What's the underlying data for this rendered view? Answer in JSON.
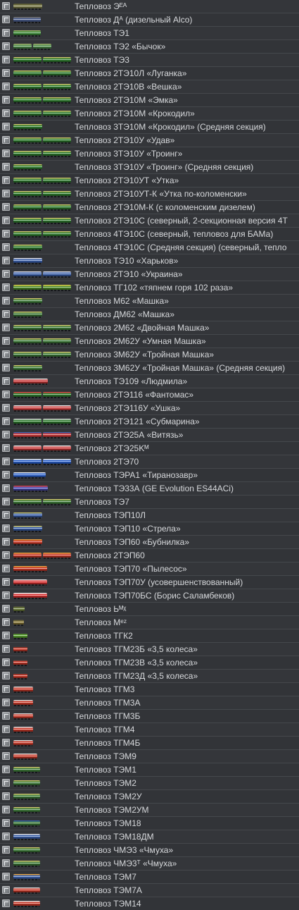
{
  "items": [
    {
      "label": "Тепловоз Эᴱᴬ",
      "thumb": {
        "colors": [
          "#7a7a4a",
          "#555533"
        ],
        "segments": 1,
        "len": 0.5
      }
    },
    {
      "label": "Тепловоз Дᴬ (дизельный Alco)",
      "thumb": {
        "colors": [
          "#4a5c8a",
          "#6d6d6d"
        ],
        "segments": 1,
        "len": 0.48
      }
    },
    {
      "label": "Тепловоз ТЭ1",
      "thumb": {
        "colors": [
          "#3e8a3a",
          "#9aaa6a"
        ],
        "segments": 1,
        "len": 0.48
      }
    },
    {
      "label": "Тепловоз ТЭ2 «Бычок»",
      "thumb": {
        "colors": [
          "#4e8a4a",
          "#9aaa6a"
        ],
        "segments": 2,
        "len": 0.66
      }
    },
    {
      "label": "Тепловоз ТЭ3",
      "thumb": {
        "colors": [
          "#2f7a2f",
          "#c8c06a"
        ],
        "segments": 2,
        "len": 1.0
      }
    },
    {
      "label": "Тепловоз 2ТЭ10Л «Луганка»",
      "thumb": {
        "colors": [
          "#2f7a2f",
          "#c8c06a"
        ],
        "segments": 2,
        "len": 1.0
      }
    },
    {
      "label": "Тепловоз 2ТЭ10В «Вешка»",
      "thumb": {
        "colors": [
          "#2f7a2f",
          "#c8c06a"
        ],
        "segments": 2,
        "len": 1.0
      }
    },
    {
      "label": "Тепловоз 2ТЭ10М «Эмка»",
      "thumb": {
        "colors": [
          "#2f7a2f",
          "#c8c06a"
        ],
        "segments": 2,
        "len": 1.0
      }
    },
    {
      "label": "Тепловоз 2ТЭ10М «Крокодил»",
      "thumb": {
        "colors": [
          "#2f7a2f",
          "#c8c06a"
        ],
        "segments": 2,
        "len": 1.0
      }
    },
    {
      "label": "Тепловоз 3ТЭ10М «Крокодил» (Средняя секция)",
      "thumb": {
        "colors": [
          "#2f7a2f",
          "#c8c06a"
        ],
        "segments": 1,
        "len": 0.5
      }
    },
    {
      "label": "Тепловоз 2ТЭ10У «Удав»",
      "thumb": {
        "colors": [
          "#2f7a2f",
          "#c8c06a"
        ],
        "segments": 2,
        "len": 1.0
      }
    },
    {
      "label": "Тепловоз 3ТЭ10У «Троинг»",
      "thumb": {
        "colors": [
          "#2f7a2f",
          "#c8c06a"
        ],
        "segments": 2,
        "len": 1.0
      }
    },
    {
      "label": "Тепловоз 3ТЭ10У «Троинг» (Средняя секция)",
      "thumb": {
        "colors": [
          "#2f7a2f",
          "#c8c06a"
        ],
        "segments": 1,
        "len": 0.5
      }
    },
    {
      "label": "Тепловоз 2ТЭ10УТ «Утка»",
      "thumb": {
        "colors": [
          "#2f7a2f",
          "#c8c06a"
        ],
        "segments": 2,
        "len": 1.0
      }
    },
    {
      "label": "Тепловоз 2ТЭ10УТ-К «Утка по-коломенски»",
      "thumb": {
        "colors": [
          "#2f7a2f",
          "#c8c06a"
        ],
        "segments": 2,
        "len": 1.0
      }
    },
    {
      "label": "Тепловоз 2ТЭ10М-К (с коломенским дизелем)",
      "thumb": {
        "colors": [
          "#2f7a2f",
          "#c8c06a"
        ],
        "segments": 2,
        "len": 1.0
      }
    },
    {
      "label": "Тепловоз 2ТЭ10С (северный, 2-секционная версия 4Т",
      "thumb": {
        "colors": [
          "#2f7a2f",
          "#c8c06a"
        ],
        "segments": 2,
        "len": 1.0
      }
    },
    {
      "label": "Тепловоз 4ТЭ10С (северный, тепловоз для БАМа)",
      "thumb": {
        "colors": [
          "#2f7a2f",
          "#c8c06a"
        ],
        "segments": 2,
        "len": 1.0
      }
    },
    {
      "label": "Тепловоз 4ТЭ10С (Средняя секция) (северный, тепло",
      "thumb": {
        "colors": [
          "#2f7a2f",
          "#c8c06a"
        ],
        "segments": 1,
        "len": 0.5
      }
    },
    {
      "label": "Тепловоз ТЭ10 «Харьков»",
      "thumb": {
        "colors": [
          "#3a5fa8",
          "#d8d8e0"
        ],
        "segments": 1,
        "len": 0.5
      }
    },
    {
      "label": "Тепловоз 2ТЭ10 «Украина»",
      "thumb": {
        "colors": [
          "#3a5fa8",
          "#d8d8e0"
        ],
        "segments": 2,
        "len": 1.0
      }
    },
    {
      "label": "Тепловоз ТГ102 «тяпнем горя 102 раза»",
      "thumb": {
        "colors": [
          "#4e8a2a",
          "#d8c84a"
        ],
        "segments": 2,
        "len": 1.0
      }
    },
    {
      "label": "Тепловоз М62 «Машка»",
      "thumb": {
        "colors": [
          "#3e7a3a",
          "#c8c06a"
        ],
        "segments": 1,
        "len": 0.5
      }
    },
    {
      "label": "Тепловоз ДМ62 «Машка»",
      "thumb": {
        "colors": [
          "#3e7a3a",
          "#c8c06a"
        ],
        "segments": 1,
        "len": 0.5
      }
    },
    {
      "label": "Тепловоз 2М62 «Двойная Машка»",
      "thumb": {
        "colors": [
          "#3e7a3a",
          "#c8c06a"
        ],
        "segments": 2,
        "len": 1.0
      }
    },
    {
      "label": "Тепловоз 2М62У «Умная Машка»",
      "thumb": {
        "colors": [
          "#3e7a3a",
          "#c8c06a"
        ],
        "segments": 2,
        "len": 1.0
      }
    },
    {
      "label": "Тепловоз 3М62У «Тройная Машка»",
      "thumb": {
        "colors": [
          "#3e7a3a",
          "#c8c06a"
        ],
        "segments": 2,
        "len": 1.0
      }
    },
    {
      "label": "Тепловоз 3М62У «Тройная Машка» (Средняя секция)",
      "thumb": {
        "colors": [
          "#3e7a3a",
          "#c8c06a"
        ],
        "segments": 1,
        "len": 0.5
      }
    },
    {
      "label": "Тепловоз ТЭ109 «Людмила»",
      "thumb": {
        "colors": [
          "#c83a3a",
          "#e0e0e0"
        ],
        "segments": 1,
        "len": 0.6
      }
    },
    {
      "label": "Тепловоз 2ТЭ116 «Фантомас»",
      "thumb": {
        "colors": [
          "#2f7a2f",
          "#d04040"
        ],
        "segments": 2,
        "len": 1.0
      }
    },
    {
      "label": "Тепловоз 2ТЭ116У «Ушка»",
      "thumb": {
        "colors": [
          "#c83a3a",
          "#e8e8e8"
        ],
        "segments": 2,
        "len": 1.0
      }
    },
    {
      "label": "Тепловоз 2ТЭ121 «Субмарина»",
      "thumb": {
        "colors": [
          "#2f7a2f",
          "#d8d8d8"
        ],
        "segments": 2,
        "len": 1.0
      }
    },
    {
      "label": "Тепловоз 2ТЭ25А «Витязь»",
      "thumb": {
        "colors": [
          "#c83a3a",
          "#3a5fa8"
        ],
        "segments": 2,
        "len": 1.0
      }
    },
    {
      "label": "Тепловоз 2ТЭ25Kᴹ",
      "thumb": {
        "colors": [
          "#c83a3a",
          "#e8e8e8"
        ],
        "segments": 2,
        "len": 1.0
      }
    },
    {
      "label": "Тепловоз 2ТЭ70",
      "thumb": {
        "colors": [
          "#2a5fc8",
          "#e8e8e8"
        ],
        "segments": 2,
        "len": 1.0
      }
    },
    {
      "label": "Тепловоз ТЭРА1 «Тиранозавр»",
      "thumb": {
        "colors": [
          "#2a5fc8",
          "#e8e8e8"
        ],
        "segments": 1,
        "len": 0.56
      }
    },
    {
      "label": "Тепловоз ТЭ33А (GE Evolution ES44ACi)",
      "thumb": {
        "colors": [
          "#4a4ab0",
          "#d04040"
        ],
        "segments": 1,
        "len": 0.6
      }
    },
    {
      "label": "Тепловоз ТЭ7",
      "thumb": {
        "colors": [
          "#3e7a3a",
          "#c8c06a"
        ],
        "segments": 2,
        "len": 1.0
      }
    },
    {
      "label": "Тепловоз ТЭП10Л",
      "thumb": {
        "colors": [
          "#3a5fa8",
          "#c8c06a"
        ],
        "segments": 1,
        "len": 0.5
      }
    },
    {
      "label": "Тепловоз ТЭП10 «Стрела»",
      "thumb": {
        "colors": [
          "#3a5fa8",
          "#c8c06a"
        ],
        "segments": 1,
        "len": 0.5
      }
    },
    {
      "label": "Тепловоз ТЭП60 «Бубнилка»",
      "thumb": {
        "colors": [
          "#c83a2a",
          "#e0a040"
        ],
        "segments": 1,
        "len": 0.5
      }
    },
    {
      "label": "Тепловоз 2ТЭП60",
      "thumb": {
        "colors": [
          "#c83a2a",
          "#e0a040"
        ],
        "segments": 2,
        "len": 1.0
      }
    },
    {
      "label": "Тепловоз ТЭП70 «Пылесос»",
      "thumb": {
        "colors": [
          "#c83a2a",
          "#e0a040"
        ],
        "segments": 1,
        "len": 0.58
      }
    },
    {
      "label": "Тепловоз ТЭП70У (усовершенствованный)",
      "thumb": {
        "colors": [
          "#d83030",
          "#e8e8e8"
        ],
        "segments": 1,
        "len": 0.58
      }
    },
    {
      "label": "Тепловоз ТЭП70БС (Борис Саламбеков)",
      "thumb": {
        "colors": [
          "#d83030",
          "#e8e8e8"
        ],
        "segments": 1,
        "len": 0.58
      }
    },
    {
      "label": "Тепловоз Ьᴹᵡ",
      "thumb": {
        "colors": [
          "#6a7a3a",
          "#4a4a3a"
        ],
        "segments": 1,
        "len": 0.2
      }
    },
    {
      "label": "Тепловоз Мᵉᶻ",
      "thumb": {
        "colors": [
          "#8a7a3a",
          "#4a4a3a"
        ],
        "segments": 1,
        "len": 0.18
      }
    },
    {
      "label": "Тепловоз ТГК2",
      "thumb": {
        "colors": [
          "#5aa030",
          "#3a3a3a"
        ],
        "segments": 1,
        "len": 0.24
      }
    },
    {
      "label": "Тепловоз ТГМ23Б «3,5 колеса»",
      "thumb": {
        "colors": [
          "#c83a2a",
          "#3a3a3a"
        ],
        "segments": 1,
        "len": 0.24
      }
    },
    {
      "label": "Тепловоз ТГМ23В «3,5 колеса»",
      "thumb": {
        "colors": [
          "#c83a2a",
          "#3a3a3a"
        ],
        "segments": 1,
        "len": 0.24
      }
    },
    {
      "label": "Тепловоз ТГМ23Д «3,5 колеса»",
      "thumb": {
        "colors": [
          "#c83a2a",
          "#3a3a3a"
        ],
        "segments": 1,
        "len": 0.24
      }
    },
    {
      "label": "Тепловоз ТГМ3",
      "thumb": {
        "colors": [
          "#c83a2a",
          "#d8d8d8"
        ],
        "segments": 1,
        "len": 0.34
      }
    },
    {
      "label": "Тепловоз ТГМ3А",
      "thumb": {
        "colors": [
          "#c83a2a",
          "#d8d8d8"
        ],
        "segments": 1,
        "len": 0.34
      }
    },
    {
      "label": "Тепловоз ТГМ3Б",
      "thumb": {
        "colors": [
          "#c83a2a",
          "#d8d8d8"
        ],
        "segments": 1,
        "len": 0.34
      }
    },
    {
      "label": "Тепловоз ТГМ4",
      "thumb": {
        "colors": [
          "#c83a2a",
          "#d8d8d8"
        ],
        "segments": 1,
        "len": 0.34
      }
    },
    {
      "label": "Тепловоз ТГМ4Б",
      "thumb": {
        "colors": [
          "#c83a2a",
          "#d8d8d8"
        ],
        "segments": 1,
        "len": 0.34
      }
    },
    {
      "label": "Тепловоз ТЭМ9",
      "thumb": {
        "colors": [
          "#c83a2a",
          "#d8d8d8"
        ],
        "segments": 1,
        "len": 0.42
      }
    },
    {
      "label": "Тепловоз ТЭМ1",
      "thumb": {
        "colors": [
          "#3e7a3a",
          "#c8c06a"
        ],
        "segments": 1,
        "len": 0.46
      }
    },
    {
      "label": "Тепловоз ТЭМ2",
      "thumb": {
        "colors": [
          "#3e7a3a",
          "#c8c06a"
        ],
        "segments": 1,
        "len": 0.46
      }
    },
    {
      "label": "Тепловоз ТЭМ2У",
      "thumb": {
        "colors": [
          "#3e7a3a",
          "#c8c06a"
        ],
        "segments": 1,
        "len": 0.46
      }
    },
    {
      "label": "Тепловоз ТЭМ2УМ",
      "thumb": {
        "colors": [
          "#3e7a3a",
          "#c8c06a"
        ],
        "segments": 1,
        "len": 0.46
      }
    },
    {
      "label": "Тепловоз ТЭМ18",
      "thumb": {
        "colors": [
          "#3e7a3a",
          "#3a5fa8"
        ],
        "segments": 1,
        "len": 0.46
      }
    },
    {
      "label": "Тепловоз ТЭМ18ДМ",
      "thumb": {
        "colors": [
          "#3a5fa8",
          "#d8d8d8"
        ],
        "segments": 1,
        "len": 0.46
      }
    },
    {
      "label": "Тепловоз ЧМЭ3 «Чмуха»",
      "thumb": {
        "colors": [
          "#3e7a3a",
          "#c8c06a"
        ],
        "segments": 1,
        "len": 0.46
      }
    },
    {
      "label": "Тепловоз ЧМЭ3ᵀ «Чмуха»",
      "thumb": {
        "colors": [
          "#3e7a3a",
          "#c8c06a"
        ],
        "segments": 1,
        "len": 0.46
      }
    },
    {
      "label": "Тепловоз ТЭМ7",
      "thumb": {
        "colors": [
          "#3a5fa8",
          "#e0a040"
        ],
        "segments": 1,
        "len": 0.46
      }
    },
    {
      "label": "Тепловоз ТЭМ7А",
      "thumb": {
        "colors": [
          "#c83a2a",
          "#d8d8d8"
        ],
        "segments": 1,
        "len": 0.46
      }
    },
    {
      "label": "Тепловоз ТЭМ14",
      "thumb": {
        "colors": [
          "#c83a2a",
          "#d8d8d8"
        ],
        "segments": 1,
        "len": 0.46
      }
    }
  ]
}
